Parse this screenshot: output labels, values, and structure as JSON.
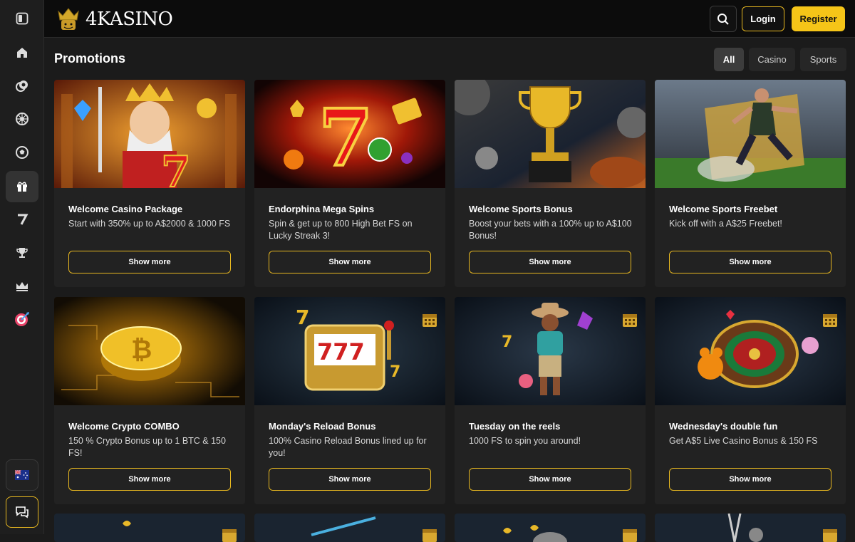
{
  "brand": {
    "logo_text": "4KASINO"
  },
  "header": {
    "search_icon": "search-icon",
    "login_label": "Login",
    "register_label": "Register"
  },
  "sidebar": {
    "items": [
      {
        "name": "toggle-sidebar-icon"
      },
      {
        "name": "home-icon"
      },
      {
        "name": "casino-chips-icon"
      },
      {
        "name": "roulette-icon"
      },
      {
        "name": "soccer-ball-icon"
      },
      {
        "name": "gift-icon"
      },
      {
        "name": "seven-icon"
      },
      {
        "name": "trophy-icon"
      },
      {
        "name": "crown-icon"
      },
      {
        "name": "target-icon"
      }
    ],
    "language_flag": "australia-flag-icon",
    "chat_icon": "chat-icon"
  },
  "page": {
    "title": "Promotions"
  },
  "filters": [
    {
      "label": "All",
      "active": true
    },
    {
      "label": "Casino",
      "active": false
    },
    {
      "label": "Sports",
      "active": false
    }
  ],
  "promotions": [
    {
      "title": "Welcome Casino Package",
      "description": "Start with 350% up to A$2000 & 1000 FS",
      "button": "Show more",
      "image": "king-with-sword-illustration"
    },
    {
      "title": "Endorphina Mega Spins",
      "description": "Spin & get up to 800 High Bet FS on Lucky Streak 3!",
      "button": "Show more",
      "image": "lucky-seven-illustration"
    },
    {
      "title": "Welcome Sports Bonus",
      "description": "Boost your bets with a 100% up to A$100 Bonus!",
      "button": "Show more",
      "image": "golden-trophy-illustration"
    },
    {
      "title": "Welcome Sports Freebet",
      "description": "Kick off with a A$25 Freebet!",
      "button": "Show more",
      "image": "soccer-player-illustration"
    },
    {
      "title": "Welcome Crypto COMBO",
      "description": "150 % Crypto Bonus up to 1 BTC & 150 FS!",
      "button": "Show more",
      "image": "bitcoin-coin-illustration"
    },
    {
      "title": "Monday's Reload Bonus",
      "description": "100% Casino Reload Bonus lined up for you!",
      "button": "Show more",
      "image": "slot-machine-illustration"
    },
    {
      "title": "Tuesday on the reels",
      "description": "1000 FS to spin you around!",
      "button": "Show more",
      "image": "cowboy-character-illustration"
    },
    {
      "title": "Wednesday's double fun",
      "description": "Get A$5 Live Casino Bonus & 150 FS",
      "button": "Show more",
      "image": "roulette-gummy-bear-illustration"
    }
  ],
  "colors": {
    "accent": "#f5c518",
    "background": "#1b1b1b",
    "card": "#222222"
  }
}
